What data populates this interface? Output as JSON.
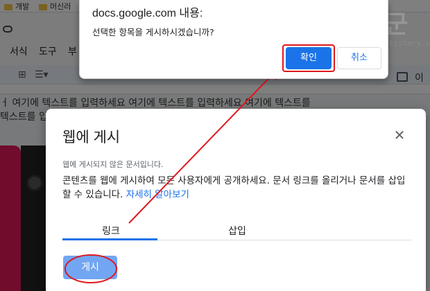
{
  "background": {
    "bookmarks": [
      "개발",
      "머신러"
    ],
    "menu": [
      "서식",
      "도구",
      "부"
    ],
    "doc_lines": [
      "ㅓ 여기에 텍스트를 입력하세요 여기에 텍스트를 입력하세요 여기에 텍스트를",
      "텍스트를 입"
    ],
    "side_text": "이"
  },
  "watermark": {
    "title": "녹두장군",
    "url": "http://mainia.tistory.com"
  },
  "confirm_dialog": {
    "title": "docs.google.com 내용:",
    "message": "선택한 항목을 게시하시겠습니까?",
    "ok_label": "확인",
    "cancel_label": "취소"
  },
  "publish_dialog": {
    "title": "웹에 게시",
    "status": "웹에 게시되지 않은 문서입니다.",
    "description": "콘텐츠를 웹에 게시하여 모든 사용자에게 공개하세요. 문서 링크를 올리거나 문서를 삽입할 수 있습니다.",
    "learn_more": "자세히 알아보기",
    "tabs": [
      "링크",
      "삽입"
    ],
    "active_tab": "링크",
    "publish_label": "게시"
  },
  "colors": {
    "accent": "#1a73e8",
    "annotation": "#e0171e",
    "publish_button": "#72a6f3"
  }
}
